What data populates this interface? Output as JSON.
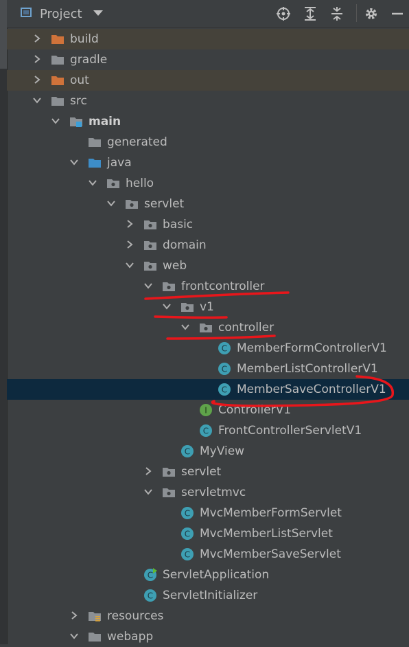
{
  "header": {
    "title": "Project",
    "icons": [
      "project-view-icon",
      "dropdown-icon",
      "locate-icon",
      "expand-all-icon",
      "collapse-all-icon",
      "settings-icon",
      "hide-icon"
    ]
  },
  "colors": {
    "background": "#3c3f41",
    "selected_row": "#0d293e",
    "excluded_row": "#45423a",
    "folder_gray": "#8c9094",
    "folder_orange": "#d0733a",
    "folder_blue": "#3d8dc8",
    "class_icon": "#3e9fb3",
    "interface_icon": "#5fa34a",
    "annotation_red": "#e8161b"
  },
  "tree": [
    {
      "label": "build",
      "level": 0,
      "arrow": "right",
      "icon": "folder-orange",
      "excluded": true
    },
    {
      "label": "gradle",
      "level": 0,
      "arrow": "right",
      "icon": "folder"
    },
    {
      "label": "out",
      "level": 0,
      "arrow": "right",
      "icon": "folder-orange",
      "excluded": true
    },
    {
      "label": "src",
      "level": 0,
      "arrow": "down",
      "icon": "folder"
    },
    {
      "label": "main",
      "level": 1,
      "arrow": "down",
      "icon": "folder-source-root",
      "bold": true
    },
    {
      "label": "generated",
      "level": 2,
      "arrow": "none",
      "icon": "folder"
    },
    {
      "label": "java",
      "level": 2,
      "arrow": "down",
      "icon": "folder-blue"
    },
    {
      "label": "hello",
      "level": 3,
      "arrow": "down",
      "icon": "package"
    },
    {
      "label": "servlet",
      "level": 4,
      "arrow": "down",
      "icon": "package"
    },
    {
      "label": "basic",
      "level": 5,
      "arrow": "right",
      "icon": "package"
    },
    {
      "label": "domain",
      "level": 5,
      "arrow": "right",
      "icon": "package"
    },
    {
      "label": "web",
      "level": 5,
      "arrow": "down",
      "icon": "package"
    },
    {
      "label": "frontcontroller",
      "level": 6,
      "arrow": "down",
      "icon": "package"
    },
    {
      "label": "v1",
      "level": 7,
      "arrow": "down",
      "icon": "package"
    },
    {
      "label": "controller",
      "level": 8,
      "arrow": "down",
      "icon": "package"
    },
    {
      "label": "MemberFormControllerV1",
      "level": 9,
      "arrow": "none",
      "icon": "class"
    },
    {
      "label": "MemberListControllerV1",
      "level": 9,
      "arrow": "none",
      "icon": "class"
    },
    {
      "label": "MemberSaveControllerV1",
      "level": 9,
      "arrow": "none",
      "icon": "class",
      "selected": true
    },
    {
      "label": "ControllerV1",
      "level": 8,
      "arrow": "none",
      "icon": "interface"
    },
    {
      "label": "FrontControllerServletV1",
      "level": 8,
      "arrow": "none",
      "icon": "class"
    },
    {
      "label": "MyView",
      "level": 7,
      "arrow": "none",
      "icon": "class"
    },
    {
      "label": "servlet",
      "level": 6,
      "arrow": "right",
      "icon": "package"
    },
    {
      "label": "servletmvc",
      "level": 6,
      "arrow": "down",
      "icon": "package"
    },
    {
      "label": "MvcMemberFormServlet",
      "level": 7,
      "arrow": "none",
      "icon": "class"
    },
    {
      "label": "MvcMemberListServlet",
      "level": 7,
      "arrow": "none",
      "icon": "class"
    },
    {
      "label": "MvcMemberSaveServlet",
      "level": 7,
      "arrow": "none",
      "icon": "class"
    },
    {
      "label": "ServletApplication",
      "level": 5,
      "arrow": "none",
      "icon": "class-run"
    },
    {
      "label": "ServletInitializer",
      "level": 5,
      "arrow": "none",
      "icon": "class"
    },
    {
      "label": "resources",
      "level": 2,
      "arrow": "right",
      "icon": "folder-resources"
    },
    {
      "label": "webapp",
      "level": 2,
      "arrow": "down",
      "icon": "folder"
    }
  ]
}
